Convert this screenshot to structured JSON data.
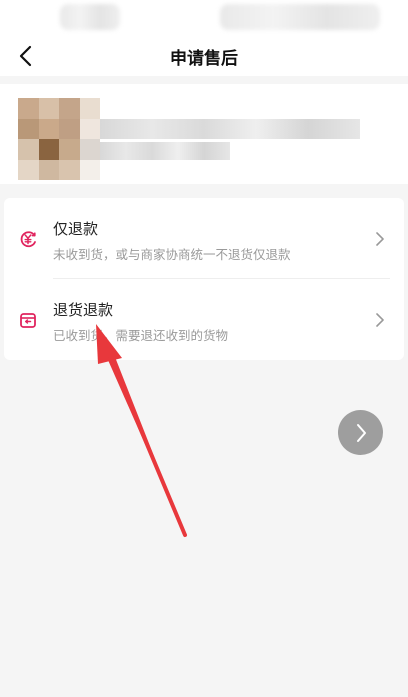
{
  "header": {
    "title": "申请售后",
    "back_icon": "chevron-left-icon"
  },
  "options": [
    {
      "title": "仅退款",
      "description": "未收到货，或与商家协商统一不退货仅退款",
      "icon": "refund-coin-icon"
    },
    {
      "title": "退货退款",
      "description": "已收到货，需要退还收到的货物",
      "icon": "return-box-icon"
    }
  ],
  "colors": {
    "accent": "#e0245e",
    "annotation": "#e8383c",
    "floating_button": "#9e9e9e"
  }
}
